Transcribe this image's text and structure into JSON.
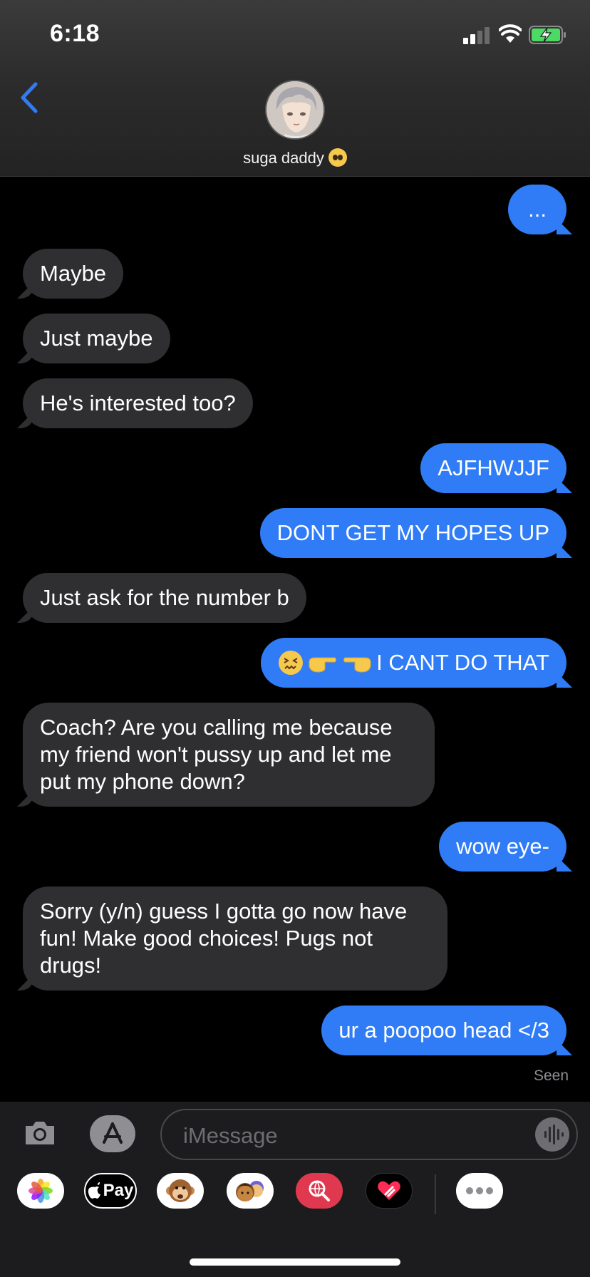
{
  "status_bar": {
    "time": "6:18"
  },
  "header": {
    "contact_name": "suga daddy"
  },
  "messages": [
    {
      "text": "...",
      "side": "out"
    },
    {
      "text": "Maybe",
      "side": "in"
    },
    {
      "text": "Just maybe",
      "side": "in"
    },
    {
      "text": "He's interested too?",
      "side": "in"
    },
    {
      "text": "AJFHWJJF",
      "side": "out"
    },
    {
      "text": "DONT GET MY HOPES UP",
      "side": "out"
    },
    {
      "text": "Just ask for the number b",
      "side": "in"
    },
    {
      "text": "I CANT DO THAT",
      "side": "out"
    },
    {
      "text": "Coach? Are you calling me because my friend won't pussy up and let me put my phone down?",
      "side": "in"
    },
    {
      "text": "wow eye-",
      "side": "out"
    },
    {
      "text": "Sorry (y/n) guess I gotta go now have fun! Make good choices! Pugs not drugs!",
      "side": "in"
    },
    {
      "text": "ur a poopoo head </3",
      "side": "out"
    }
  ],
  "read_receipt": "Seen",
  "compose": {
    "placeholder": "iMessage"
  },
  "app_drawer": {
    "apple_pay_label": "Pay"
  },
  "colors": {
    "outgoing": "#2f7cf6",
    "incoming": "#2f2f32",
    "accent": "#2f7cf6"
  },
  "icons": [
    "back-chevron-icon",
    "camera-icon",
    "app-store-icon",
    "audio-waveform-icon",
    "photos-icon",
    "apple-pay-icon",
    "monkey-animoji-icon",
    "memoji-icon",
    "web-search-icon",
    "digital-touch-icon",
    "more-icon"
  ]
}
